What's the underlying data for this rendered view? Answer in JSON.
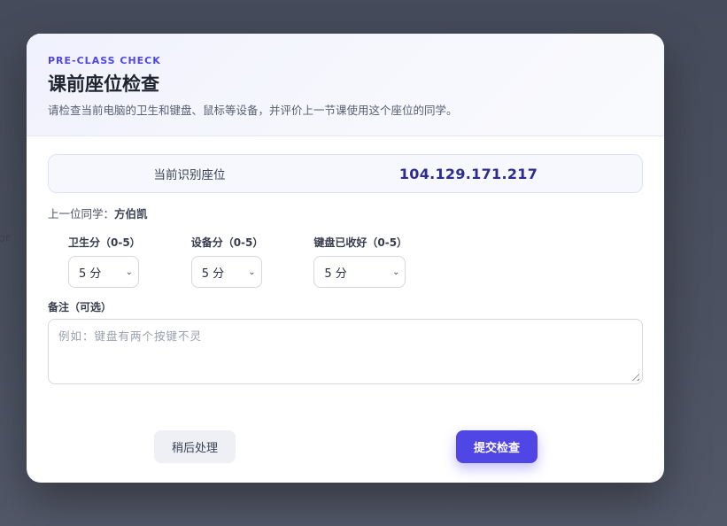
{
  "backdrop": {
    "partial_text": "or"
  },
  "modal": {
    "eyebrow": "PRE-CLASS CHECK",
    "title": "课前座位检查",
    "subtitle": "请检查当前电脑的卫生和键盘、鼠标等设备，并评价上一节课使用这个座位的同学。"
  },
  "seat": {
    "label": "当前识别座位",
    "value": "104.129.171.217"
  },
  "previous": {
    "label": "上一位同学：",
    "name": "方伯凯"
  },
  "scores": [
    {
      "label": "卫生分（0-5）",
      "value": "5 分"
    },
    {
      "label": "设备分（0-5）",
      "value": "5 分"
    },
    {
      "label": "键盘已收好（0-5）",
      "value": "5 分"
    }
  ],
  "note": {
    "label": "备注（可选）",
    "placeholder": "例如：键盘有两个按键不灵"
  },
  "buttons": {
    "later": "稍后处理",
    "submit": "提交检查"
  },
  "colors": {
    "accent": "#4f46e5",
    "seat_value": "#2e2b8f"
  }
}
